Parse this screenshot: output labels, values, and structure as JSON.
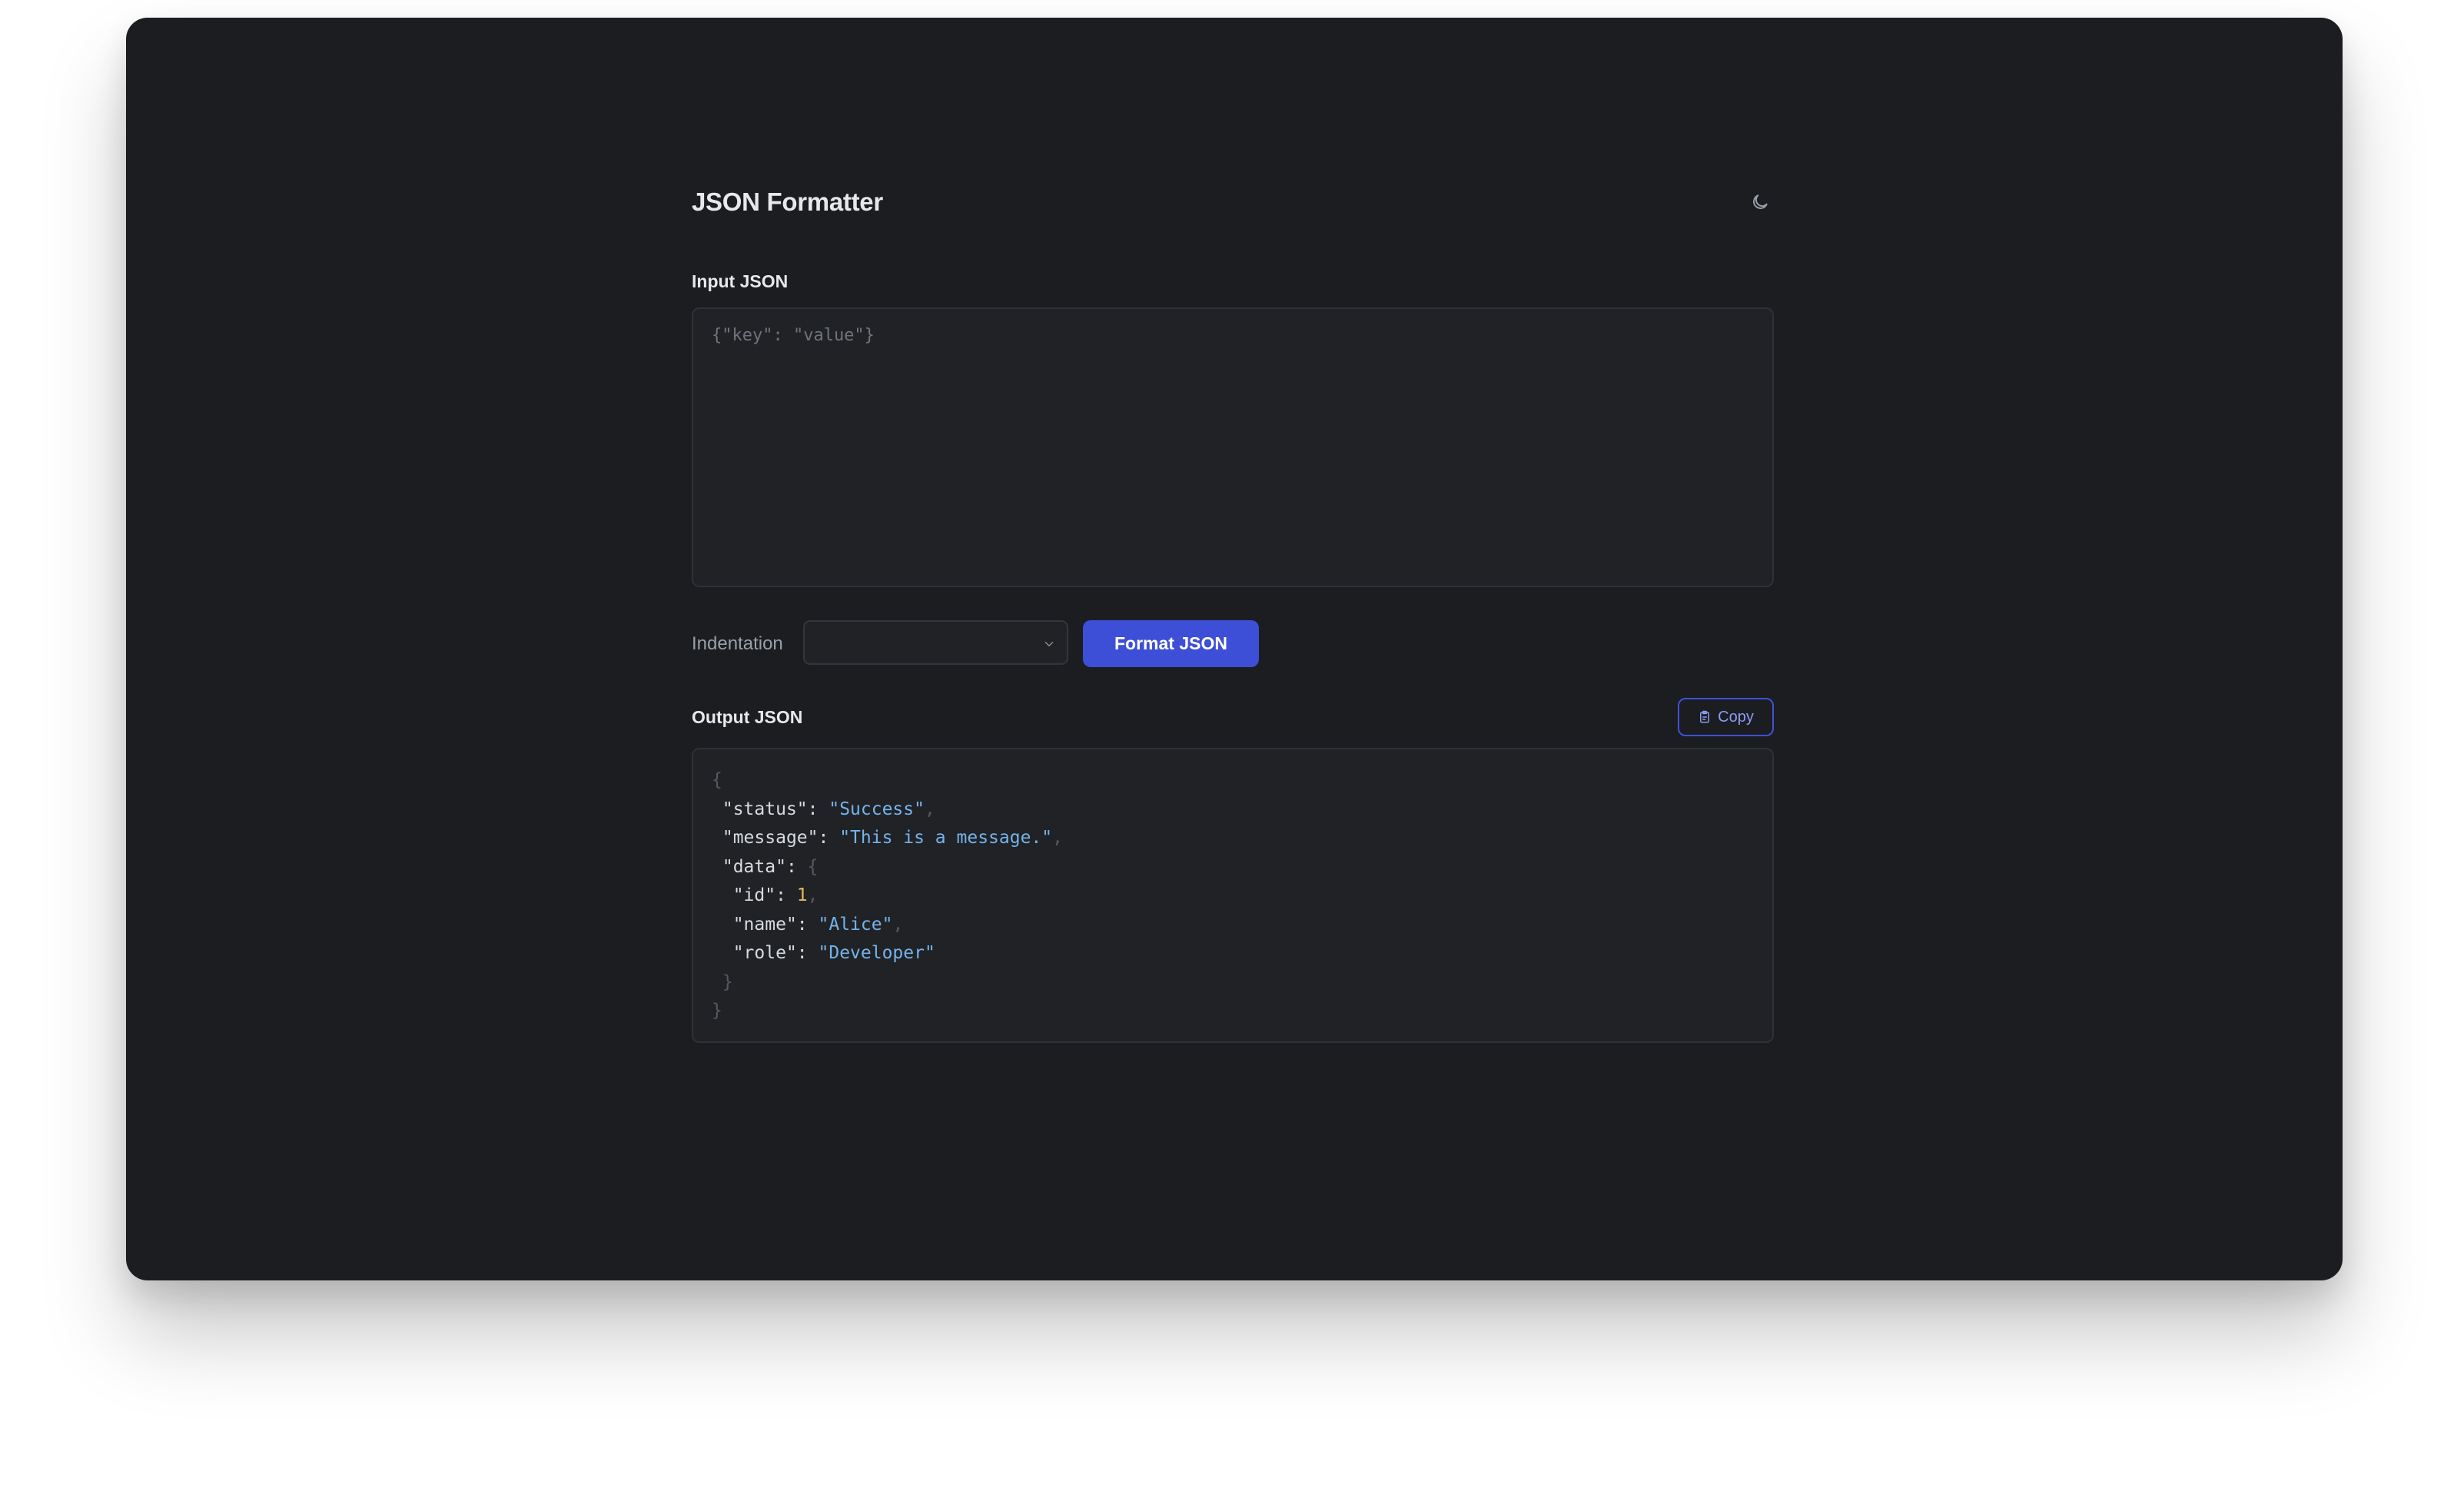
{
  "app": {
    "title": "JSON Formatter",
    "theme_toggle_icon": "moon-icon"
  },
  "input": {
    "label": "Input JSON",
    "placeholder": "{\"key\": \"value\"}",
    "value": ""
  },
  "controls": {
    "indentation_label": "Indentation",
    "indentation_value": "",
    "format_button_label": "Format JSON"
  },
  "output": {
    "label": "Output JSON",
    "copy_button_label": "Copy",
    "copy_icon": "clipboard-icon",
    "lines": [
      [
        {
          "t": "punct",
          "v": "{"
        }
      ],
      [
        {
          "t": "indent",
          "v": " "
        },
        {
          "t": "key",
          "v": "\"status\""
        },
        {
          "t": "colon",
          "v": ": "
        },
        {
          "t": "str",
          "v": "\"Success\""
        },
        {
          "t": "punct",
          "v": ","
        }
      ],
      [
        {
          "t": "indent",
          "v": " "
        },
        {
          "t": "key",
          "v": "\"message\""
        },
        {
          "t": "colon",
          "v": ": "
        },
        {
          "t": "str",
          "v": "\"This is a message.\""
        },
        {
          "t": "punct",
          "v": ","
        }
      ],
      [
        {
          "t": "indent",
          "v": " "
        },
        {
          "t": "key",
          "v": "\"data\""
        },
        {
          "t": "colon",
          "v": ": "
        },
        {
          "t": "punct",
          "v": "{"
        }
      ],
      [
        {
          "t": "indent",
          "v": "  "
        },
        {
          "t": "key",
          "v": "\"id\""
        },
        {
          "t": "colon",
          "v": ": "
        },
        {
          "t": "num",
          "v": "1"
        },
        {
          "t": "punct",
          "v": ","
        }
      ],
      [
        {
          "t": "indent",
          "v": "  "
        },
        {
          "t": "key",
          "v": "\"name\""
        },
        {
          "t": "colon",
          "v": ": "
        },
        {
          "t": "str",
          "v": "\"Alice\""
        },
        {
          "t": "punct",
          "v": ","
        }
      ],
      [
        {
          "t": "indent",
          "v": "  "
        },
        {
          "t": "key",
          "v": "\"role\""
        },
        {
          "t": "colon",
          "v": ": "
        },
        {
          "t": "str",
          "v": "\"Developer\""
        }
      ],
      [
        {
          "t": "indent",
          "v": " "
        },
        {
          "t": "punct",
          "v": "}"
        }
      ],
      [
        {
          "t": "punct",
          "v": "}"
        }
      ]
    ]
  },
  "colors": {
    "background": "#1b1d21",
    "panel": "#202226",
    "accent": "#3d4fd6",
    "string": "#76b3ea",
    "number": "#e5b95c",
    "punctuation": "#55595f"
  }
}
